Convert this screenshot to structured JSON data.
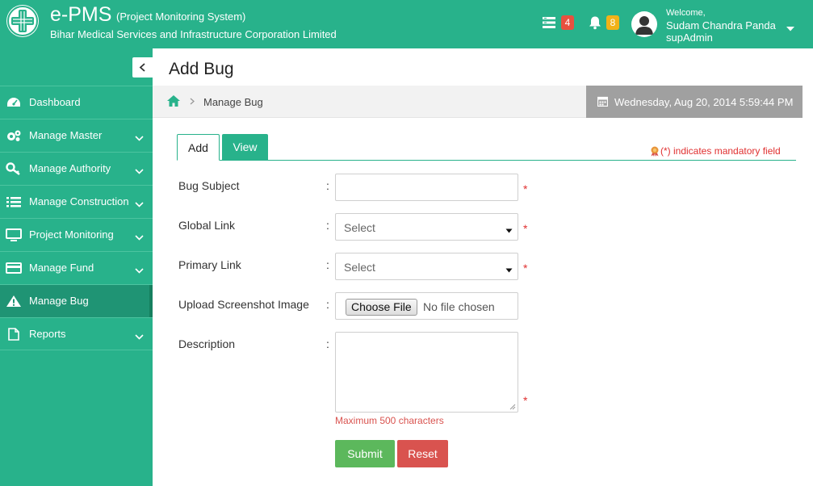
{
  "header": {
    "app_title": "e-PMS",
    "app_subtitle": "(Project Monitoring System)",
    "org_name": "Bihar Medical Services and Infrastructure Corporation Limited",
    "tasks_count": "4",
    "notifications_count": "8",
    "welcome": "Welcome,",
    "user_name": "Sudam Chandra Panda",
    "user_role": "supAdmin"
  },
  "sidebar": {
    "items": [
      {
        "label": "Dashboard",
        "icon": "dashboard-icon"
      },
      {
        "label": "Manage Master",
        "icon": "gears-icon"
      },
      {
        "label": "Manage Authority",
        "icon": "key-icon"
      },
      {
        "label": "Manage Construction",
        "icon": "list-icon"
      },
      {
        "label": "Project Monitoring",
        "icon": "monitor-icon"
      },
      {
        "label": "Manage Fund",
        "icon": "credit-card-icon"
      },
      {
        "label": "Manage Bug",
        "icon": "warning-icon"
      },
      {
        "label": "Reports",
        "icon": "file-icon"
      }
    ],
    "active_item": "Manage Bug"
  },
  "page": {
    "title": "Add Bug",
    "breadcrumb": "Manage Bug",
    "datetime": "Wednesday, Aug 20, 2014 5:59:44 PM"
  },
  "tabs": [
    {
      "label": "Add",
      "active": true
    },
    {
      "label": "View",
      "active": false
    }
  ],
  "mandatory_note": "(*) indicates mandatory field",
  "form": {
    "colon": ":",
    "required_mark": "*",
    "bug_subject": {
      "label": "Bug Subject",
      "value": ""
    },
    "global_link": {
      "label": "Global Link",
      "selected": "Select"
    },
    "primary_link": {
      "label": "Primary Link",
      "selected": "Select"
    },
    "upload": {
      "label": "Upload Screenshot Image",
      "button": "Choose File",
      "status": "No file chosen"
    },
    "description": {
      "label": "Description",
      "value": "",
      "hint": "Maximum 500 characters"
    },
    "submit_label": "Submit",
    "reset_label": "Reset"
  },
  "colors": {
    "brand": "#28b28b",
    "sidebar_active": "#1f9474",
    "required": "#e03030",
    "submit": "#5cb85c",
    "reset": "#d9534f",
    "date_box": "#a0a0a0"
  }
}
